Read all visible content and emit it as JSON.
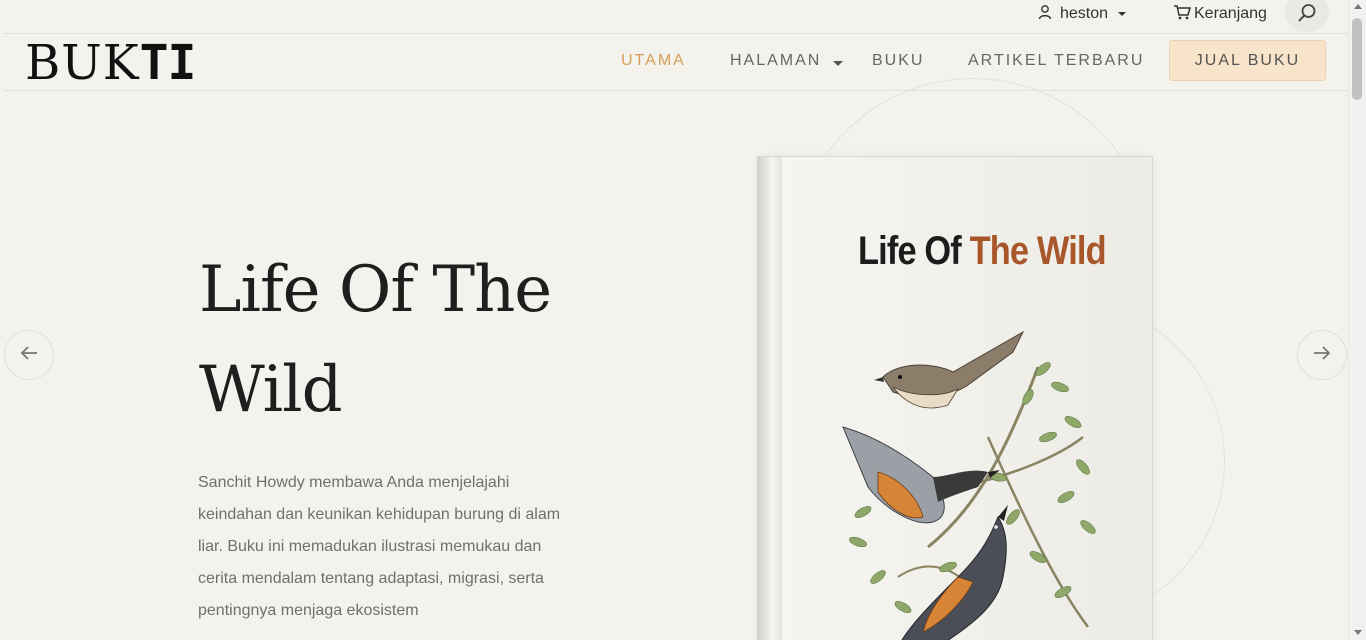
{
  "topbar": {
    "user_name": "heston",
    "cart_label": "Keranjang",
    "user_icon": "user-icon",
    "cart_icon": "cart-icon",
    "search_icon": "search-icon"
  },
  "header": {
    "logo_light": "BUK",
    "logo_bold": "TI",
    "nav": {
      "home": "UTAMA",
      "pages": "HALAMAN",
      "books": "BUKU",
      "articles": "ARTIKEL TERBARU"
    },
    "sell_button": "JUAL BUKU",
    "active_color": "#d6a057",
    "sell_bg": "#f8e3cb"
  },
  "hero": {
    "title": "Life Of The Wild",
    "description": "Sanchit Howdy membawa Anda menjelajahi keindahan dan keunikan kehidupan burung di alam liar. Buku ini memadukan ilustrasi memukau dan cerita mendalam tentang adaptasi, migrasi, serta pentingnya menjaga ekosistem",
    "prev_icon": "arrow-left-icon",
    "next_icon": "arrow-right-icon",
    "book_cover": {
      "title_dark": "Life Of",
      "title_accent": "The Wild",
      "accent_color": "#a8572a"
    }
  }
}
